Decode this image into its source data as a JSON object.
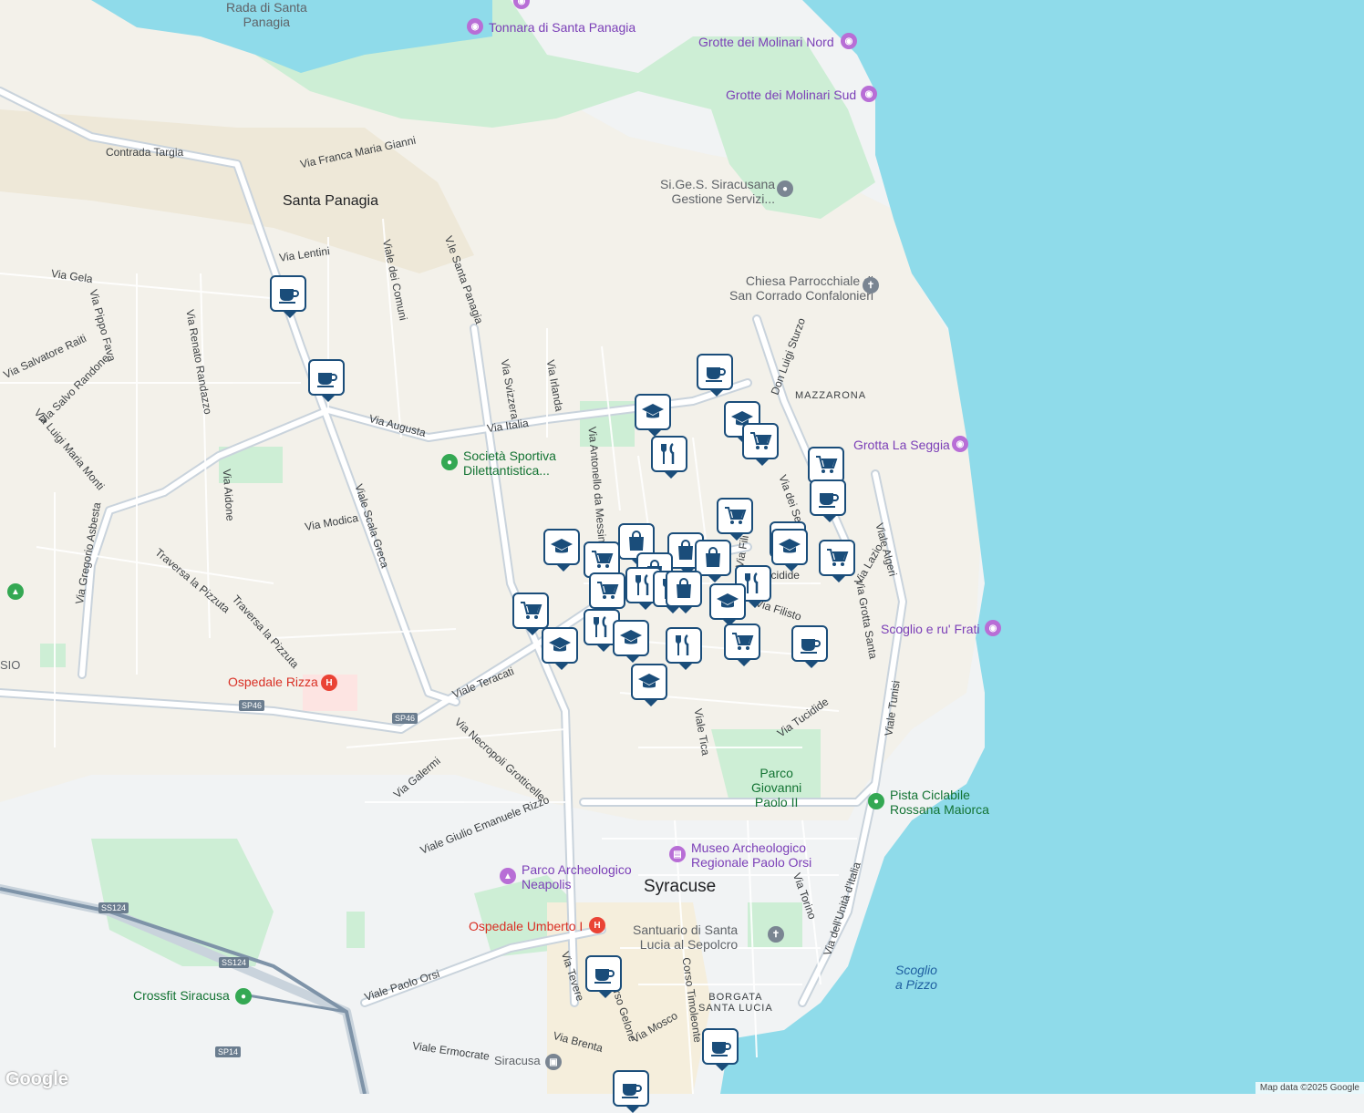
{
  "colors": {
    "land": "#f1f3f4",
    "sea": "#8fdbea",
    "park": "#cdeed5",
    "sand": "#f5efe0",
    "road": "#ffffff",
    "road_edge": "#c9d3dc",
    "pin_border": "#1a4d7a"
  },
  "areas": {
    "santa_panagia": "Santa Panagia",
    "syracuse": "Syracuse",
    "borgata": "BORGATA\nSANTA LUCIA",
    "mazzarona": "MAZZARONA"
  },
  "streets": [
    "Contrada Targia",
    "Via Franca Maria Gianni",
    "Via Lentini",
    "Viale dei Comuni",
    "V.le Santa Panagia",
    "Via Gela",
    "Via Pippo Fava",
    "Via Renato Randazzo",
    "Via Salvatore Raiti",
    "Via Salvo Randone",
    "Via Luigi Maria Monti",
    "Via Augusta",
    "Via Svizzera",
    "Via Irlanda",
    "Via Italia",
    "Via Antonello da Messina",
    "Don Luigi Sturzo",
    "Viale Scala Greca",
    "Via Aidone",
    "Via Modica",
    "Via Gregorio Asbesta",
    "Traversa la Pizzuta",
    "Viale Teracati",
    "Via Necropoli Grotticelle",
    "Via Galermi",
    "Viale Giulio Emanuele Rizzo",
    "Viale Tica",
    "Via Tucidide",
    "Via Filisto",
    "Via Grotta Santa",
    "Viale Algeri",
    "Viale Tunisi",
    "Via dell'Unità d'Italia",
    "Via Torino",
    "Viale Paolo Orsi",
    "Viale Ermocrate",
    "Via Brenta",
    "Via Mosco",
    "Corso Timoleonte",
    "Corso Gelone",
    "Via Tevere",
    "Via Lazio",
    "Via dei Se",
    "Via Fili",
    "Tucidide"
  ],
  "pois": {
    "rada": "Rada di Santa\nPanagia",
    "tonnara": "Tonnara di Santa Panagia",
    "grotte_nord": "Grotte dei Molinari Nord",
    "grotte_sud": "Grotte dei Molinari Sud",
    "sigesi": "Si.Ge.S. Siracusana\nGestione Servizi...",
    "chiesa": "Chiesa Parrocchiale di\nSan Corrado Confalonieri",
    "grotta_seggia": "Grotta La Seggia",
    "societa": "Società Sportiva\nDilettantistica...",
    "scoglio_frati": "Scoglio e ru' Frati",
    "ospedale_rizza": "Ospedale Rizza",
    "parco_gp": "Parco\nGiovanni\nPaolo II",
    "pista": "Pista Ciclabile\nRossana Maiorca",
    "museo": "Museo Archeologico\nRegionale Paolo Orsi",
    "neapolis": "Parco Archeologico\nNeapolis",
    "ospedale_umberto": "Ospedale Umberto I",
    "santuario": "Santuario di Santa\nLucia al Sepolcro",
    "scoglio_pizzo": "Scoglio\na Pizzo",
    "crossfit": "Crossfit Siracusa",
    "siracusa": "Siracusa",
    "sio": "SIO"
  },
  "routes": {
    "sp46": "SP46",
    "ss124": "SS124",
    "sp14": "SP14"
  },
  "attribution": "Map data ©2025 Google",
  "logo": "Google"
}
